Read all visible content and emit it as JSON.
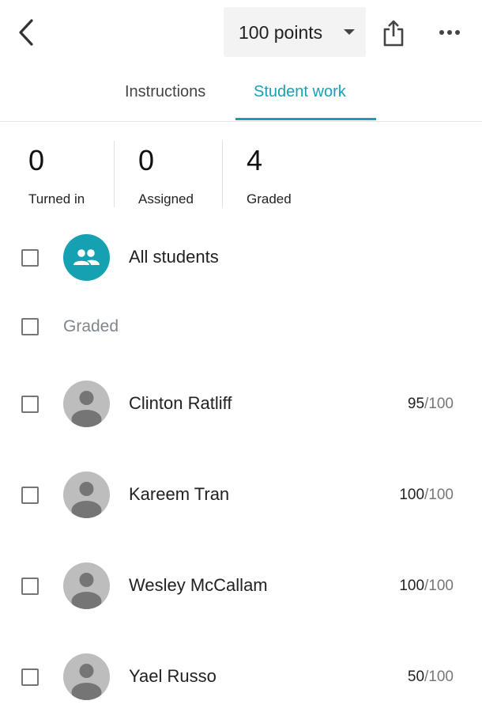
{
  "header": {
    "back_icon": "chevron-left-icon",
    "points_selector": {
      "value": "100 points",
      "icon": "dropdown-caret-icon"
    },
    "share_icon": "share-upload-icon",
    "more_icon": "more-horizontal-icon"
  },
  "tabs": [
    {
      "label": "Instructions",
      "active": false
    },
    {
      "label": "Student work",
      "active": true
    }
  ],
  "stats": [
    {
      "value": "0",
      "label": "Turned in"
    },
    {
      "value": "0",
      "label": "Assigned"
    },
    {
      "value": "4",
      "label": "Graded"
    }
  ],
  "all_students": {
    "label": "All students",
    "icon": "group-icon"
  },
  "section": {
    "label": "Graded"
  },
  "students": [
    {
      "name": "Clinton Ratliff",
      "grade": "95",
      "total": "/100"
    },
    {
      "name": "Kareem Tran",
      "grade": "100",
      "total": "/100"
    },
    {
      "name": "Wesley McCallam",
      "grade": "100",
      "total": "/100"
    },
    {
      "name": "Yael Russo",
      "grade": "50",
      "total": "/100"
    }
  ],
  "colors": {
    "accent": "#16a1b3",
    "avatar_bg": "#bdbdbd",
    "avatar_fg": "#757575"
  }
}
